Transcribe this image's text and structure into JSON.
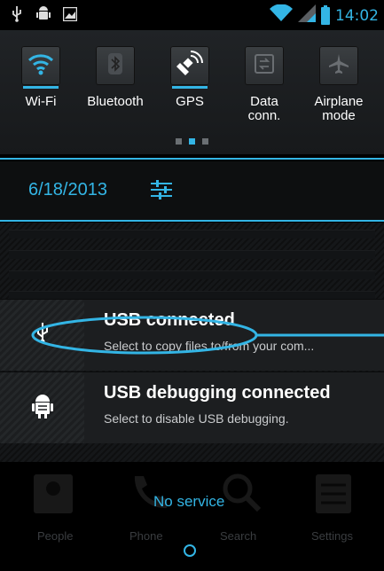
{
  "status_bar": {
    "icons": [
      "usb-icon",
      "android-debug-icon",
      "image-notification-icon",
      "wifi-signal-icon",
      "cell-signal-icon",
      "battery-charging-icon"
    ],
    "time": "14:02"
  },
  "quick_settings": {
    "tiles": [
      {
        "label": "Wi-Fi",
        "icon": "wifi-icon",
        "active": true
      },
      {
        "label": "Bluetooth",
        "icon": "bluetooth-icon",
        "active": false
      },
      {
        "label": "GPS",
        "icon": "gps-icon",
        "active": true
      },
      {
        "label": "Data\nconn.",
        "icon": "data-connection-icon",
        "active": false
      },
      {
        "label": "Airplane\nmode",
        "icon": "airplane-icon",
        "active": false
      }
    ],
    "page_indicator": {
      "count": 3,
      "active_index": 1
    }
  },
  "date_row": {
    "date": "6/18/2013",
    "icon": "settings-sliders-icon"
  },
  "notifications": [
    {
      "title": "USB connected",
      "text": "Select to copy files to/from your com...",
      "icon": "usb-icon"
    },
    {
      "title": "USB debugging connected",
      "text": "Select to disable USB debugging.",
      "icon": "android-debug-icon"
    }
  ],
  "home": {
    "status_text": "No service",
    "apps": [
      "People",
      "Phone",
      "Search",
      "Settings"
    ]
  },
  "colors": {
    "accent": "#33b5e5",
    "background": "#000000",
    "panel": "#1c1e20"
  }
}
